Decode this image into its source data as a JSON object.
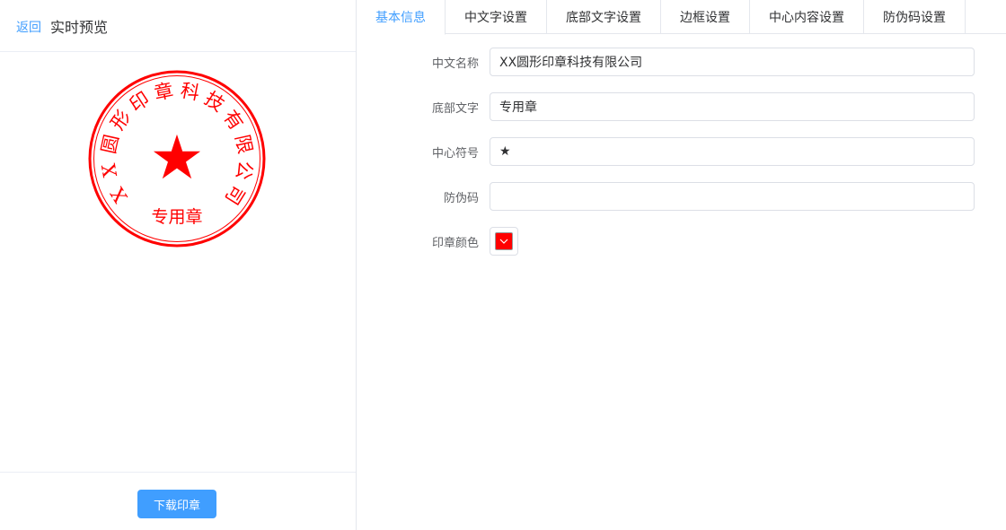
{
  "header": {
    "back_label": "返回",
    "title": "实时预览"
  },
  "seal": {
    "company_name": "XX圆形印章科技有限公司",
    "bottom_text": "专用章",
    "center_symbol": "★",
    "color": "#ff0000"
  },
  "footer": {
    "download_label": "下载印章"
  },
  "tabs": [
    {
      "label": "基本信息",
      "active": true
    },
    {
      "label": "中文字设置",
      "active": false
    },
    {
      "label": "底部文字设置",
      "active": false
    },
    {
      "label": "边框设置",
      "active": false
    },
    {
      "label": "中心内容设置",
      "active": false
    },
    {
      "label": "防伪码设置",
      "active": false
    }
  ],
  "form": {
    "name_label": "中文名称",
    "name_value": "XX圆形印章科技有限公司",
    "bottom_label": "底部文字",
    "bottom_value": "专用章",
    "symbol_label": "中心符号",
    "symbol_value": "★",
    "code_label": "防伪码",
    "code_value": "",
    "color_label": "印章颜色",
    "color_value": "#ff0000"
  }
}
